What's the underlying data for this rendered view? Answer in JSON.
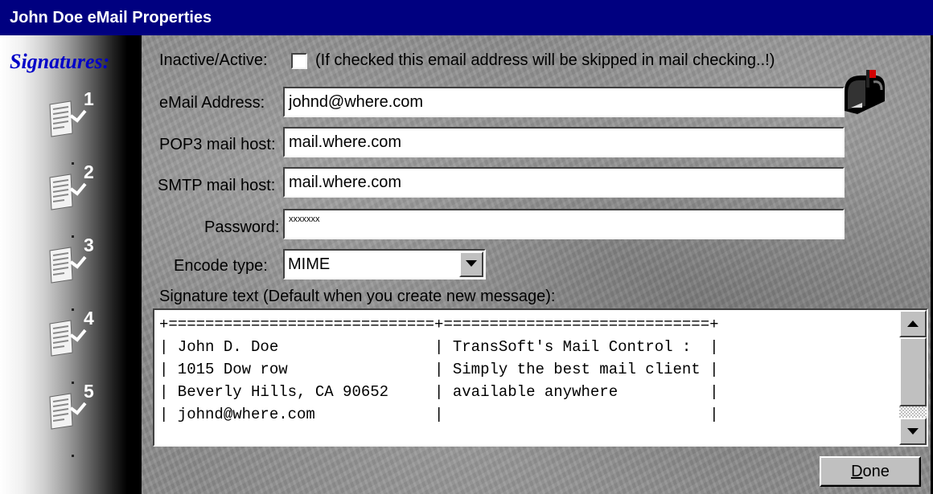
{
  "window": {
    "title": "John Doe eMail Properties"
  },
  "sidebar": {
    "title": "Signatures:",
    "signatures": [
      {
        "number": "1",
        "icon": "signature-document-icon"
      },
      {
        "number": "2",
        "icon": "signature-document-icon"
      },
      {
        "number": "3",
        "icon": "signature-document-icon"
      },
      {
        "number": "4",
        "icon": "signature-document-icon"
      },
      {
        "number": "5",
        "icon": "signature-document-icon"
      }
    ]
  },
  "form": {
    "active_label": "Inactive/Active:",
    "active_checked": false,
    "active_hint": "(If checked this email address will be skipped in mail checking..!)",
    "email_label": "eMail Address:",
    "email_value": "johnd@where.com",
    "pop3_label": "POP3 mail host:",
    "pop3_value": "mail.where.com",
    "smtp_label": "SMTP mail host:",
    "smtp_value": "mail.where.com",
    "password_label": "Password:",
    "password_value": "xxxxxxx",
    "encode_label": "Encode type:",
    "encode_value": "MIME",
    "signature_label": "Signature text (Default when you create new message):",
    "signature_text": "+=============================+=============================+\n| John D. Doe                 | TransSoft's Mail Control :  |\n| 1015 Dow row                | Simply the best mail client |\n| Beverly Hills, CA 90652     | available anywhere          |\n| johnd@where.com             |                             |"
  },
  "buttons": {
    "done_mnemonic": "D",
    "done_rest": "one"
  },
  "icons": {
    "mailbox": "mailbox-icon",
    "dropdown": "chevron-down-icon",
    "scroll_up": "arrow-up-icon",
    "scroll_down": "arrow-down-icon"
  },
  "colors": {
    "title_bar": "#000080",
    "sidebar_title": "#0000c8",
    "window_bg": "#c0c0c0"
  }
}
